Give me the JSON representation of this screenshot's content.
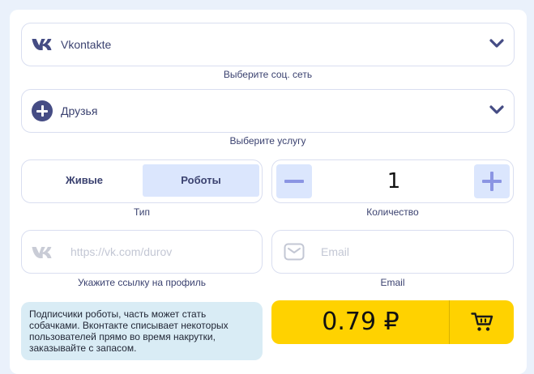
{
  "social": {
    "value": "Vkontakte",
    "caption": "Выберите соц. сеть"
  },
  "service": {
    "value": "Друзья",
    "caption": "Выберите услугу"
  },
  "type": {
    "options": [
      "Живые",
      "Роботы"
    ],
    "selected": "Роботы",
    "caption": "Тип"
  },
  "quantity": {
    "value": "1",
    "caption": "Количество"
  },
  "profile": {
    "placeholder": "https://vk.com/durov",
    "caption": "Укажите ссылку на профиль"
  },
  "email": {
    "placeholder": "Email",
    "caption": "Email"
  },
  "note": "Подписчики роботы, часть может стать собачками. Вконтакте списывает некоторых пользователей прямо во время накрутки, заказывайте с запасом.",
  "order": {
    "price": "0.79 ₽"
  },
  "colors": {
    "accent": "#454c84",
    "highlight": "#dbe6fd",
    "buy": "#ffd200",
    "note_bg": "#d9ecf5"
  },
  "icons": [
    "vk-icon",
    "chevron-down-icon",
    "plus-circle-icon",
    "minus-icon",
    "plus-icon",
    "envelope-icon",
    "cart-icon"
  ]
}
